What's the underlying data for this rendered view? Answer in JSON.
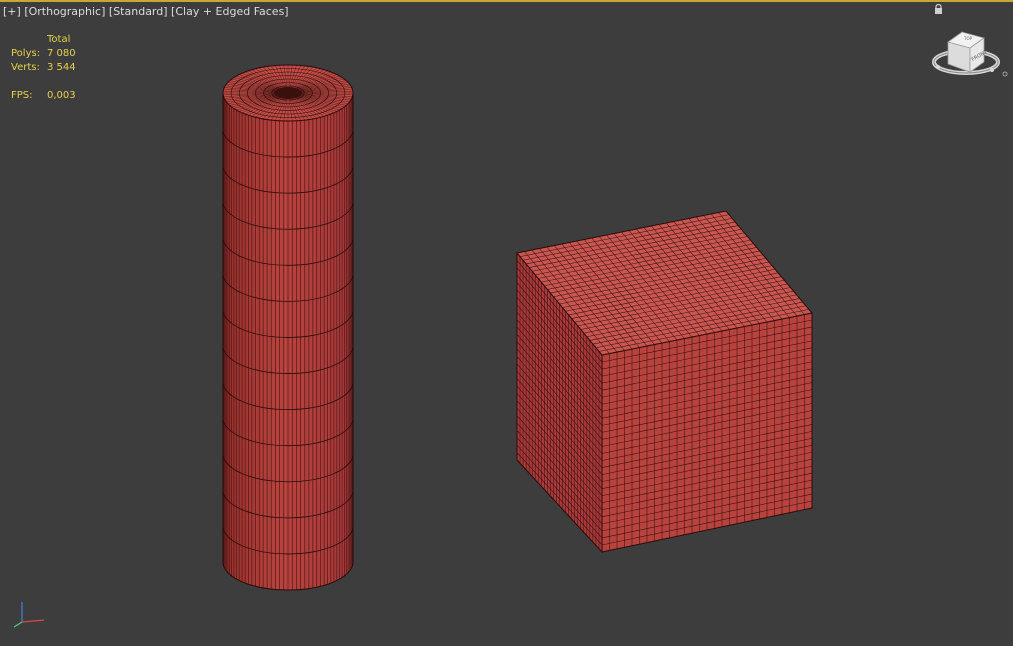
{
  "viewport": {
    "labels": {
      "plus": "[+]",
      "view": "[Orthographic]",
      "shading_preset": "[Standard]",
      "shading_mode": "[Clay + Edged Faces]"
    },
    "stats": {
      "header": "Total",
      "polys_label": "Polys:",
      "polys_value": "7 080",
      "verts_label": "Verts:",
      "verts_value": "3 544",
      "fps_label": "FPS:",
      "fps_value": "0,003"
    },
    "viewcube": {
      "face_label": "FRONT",
      "top_face_label": "TOP"
    },
    "colors": {
      "background": "#3d3d3d",
      "clay": "#b8433e",
      "wire": "#2a0b0a",
      "stats_text": "#e6d24a",
      "label_text": "#dcdcdc",
      "active_frame": "#c8a82e"
    },
    "icons": [
      "lock-icon",
      "viewcube-icon",
      "axis-tripod-icon"
    ]
  }
}
